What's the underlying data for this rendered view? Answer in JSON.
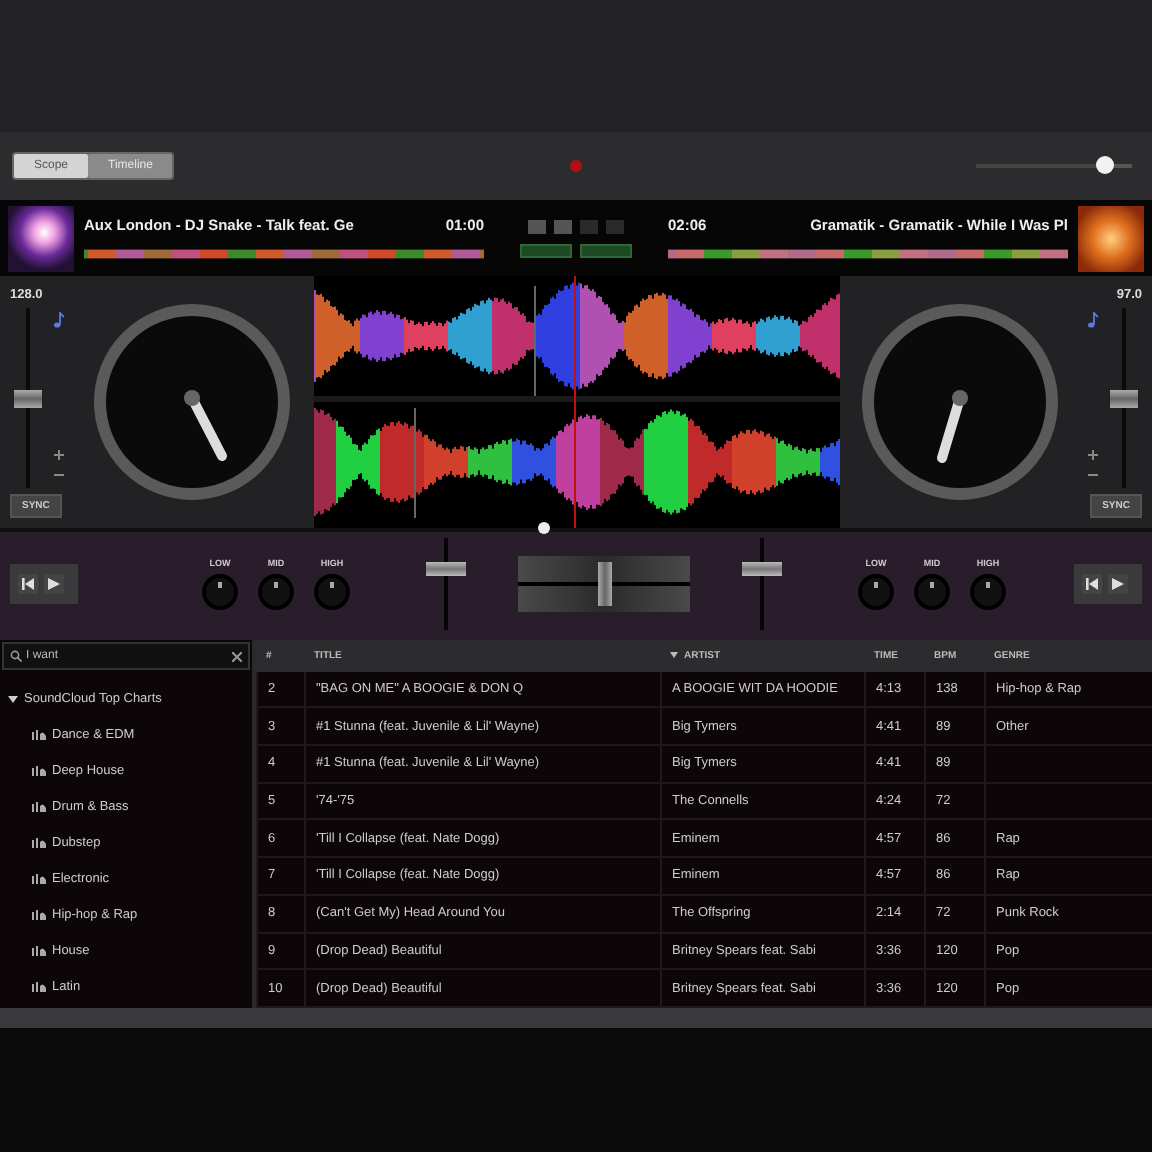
{
  "toolbar": {
    "view_tabs": [
      {
        "label": "Scope",
        "selected": true
      },
      {
        "label": "Timeline",
        "selected": false
      }
    ],
    "zoom_slider": {
      "level": 0.82
    }
  },
  "decks": [
    {
      "title": "Aux London - DJ Snake - Talk feat. Ge",
      "time": "01:00",
      "bpm": "128.0",
      "pitch": {
        "level": 0.5
      },
      "sync": "SYNC"
    },
    {
      "title": "Gramatik - Gramatik - While I Was Pl",
      "time": "02:06",
      "bpm": "97.0",
      "pitch": {
        "level": 0.5
      },
      "sync": "SYNC"
    }
  ],
  "mixer": {
    "channels": [
      {
        "eq": [
          "LOW",
          "MID",
          "HIGH"
        ],
        "fader": {
          "level": 0.72
        }
      },
      {
        "eq": [
          "LOW",
          "MID",
          "HIGH"
        ],
        "fader": {
          "level": 0.72
        }
      }
    ],
    "crossfader": {
      "level": 0.5
    }
  },
  "library": {
    "search": {
      "value": "I want"
    },
    "sidebar": [
      {
        "label": "SoundCloud Top Charts",
        "expanded": true,
        "children": [
          {
            "label": "Dance & EDM"
          },
          {
            "label": "Deep House"
          },
          {
            "label": "Drum & Bass"
          },
          {
            "label": "Dubstep"
          },
          {
            "label": "Electronic"
          },
          {
            "label": "Hip-hop & Rap"
          },
          {
            "label": "House"
          },
          {
            "label": "Latin"
          }
        ]
      }
    ],
    "columns": [
      {
        "label": "#",
        "sorted": false
      },
      {
        "label": "TITLE",
        "sorted": false
      },
      {
        "label": "ARTIST",
        "sorted": true
      },
      {
        "label": "TIME",
        "sorted": false
      },
      {
        "label": "BPM",
        "sorted": false
      },
      {
        "label": "GENRE",
        "sorted": false
      }
    ],
    "rows": [
      [
        "2",
        "\"BAG ON ME\" A BOOGIE & DON Q",
        "A BOOGIE WIT DA HOODIE",
        "4:13",
        "138",
        "Hip-hop & Rap"
      ],
      [
        "3",
        "#1 Stunna (feat. Juvenile & Lil' Wayne)",
        "Big Tymers",
        "4:41",
        "89",
        "Other"
      ],
      [
        "4",
        "#1 Stunna (feat. Juvenile & Lil' Wayne)",
        "Big Tymers",
        "4:41",
        "89",
        ""
      ],
      [
        "5",
        "'74-'75",
        "The Connells",
        "4:24",
        "72",
        ""
      ],
      [
        "6",
        "'Till I Collapse (feat. Nate Dogg)",
        "Eminem",
        "4:57",
        "86",
        "Rap"
      ],
      [
        "7",
        "'Till I Collapse (feat. Nate Dogg)",
        "Eminem",
        "4:57",
        "86",
        "Rap"
      ],
      [
        "8",
        "(Can't Get My) Head Around You",
        "The Offspring",
        "2:14",
        "72",
        "Punk Rock"
      ],
      [
        "9",
        "(Drop Dead) Beautiful",
        "Britney Spears feat. Sabi",
        "3:36",
        "120",
        "Pop"
      ],
      [
        "10",
        "(Drop Dead) Beautiful",
        "Britney Spears feat. Sabi",
        "3:36",
        "120",
        "Pop"
      ]
    ]
  }
}
